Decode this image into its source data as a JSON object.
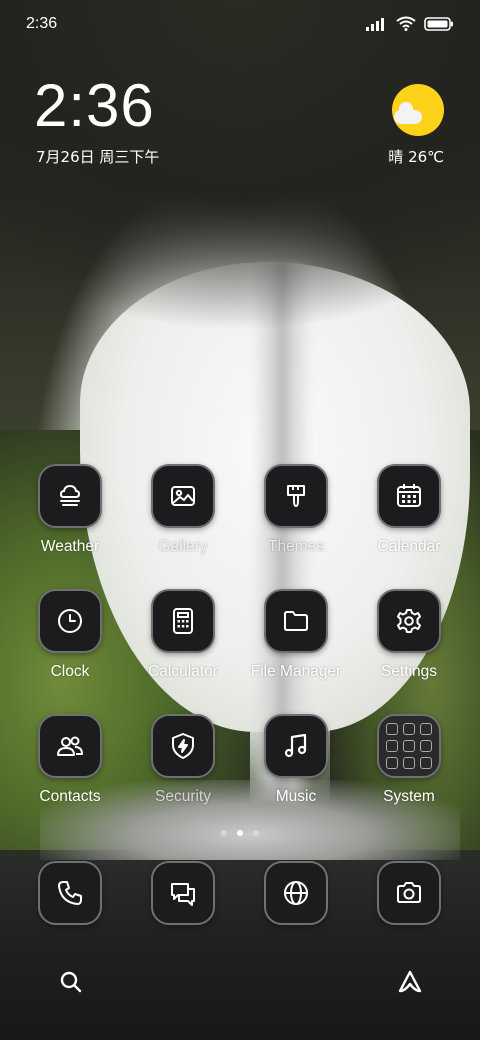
{
  "status_bar": {
    "time": "2:36"
  },
  "clock_widget": {
    "time": "2:36",
    "date": "7月26日 周三下午"
  },
  "weather_widget": {
    "text": "晴 26℃",
    "icon": "sun-cloud-icon",
    "sun_color": "#ffd21a"
  },
  "apps": [
    {
      "label": "Weather",
      "icon": "weather-icon"
    },
    {
      "label": "Gallery",
      "icon": "gallery-icon"
    },
    {
      "label": "Themes",
      "icon": "brush-icon"
    },
    {
      "label": "Calendar",
      "icon": "calendar-icon"
    },
    {
      "label": "Clock",
      "icon": "clock-icon"
    },
    {
      "label": "Calculator",
      "icon": "calculator-icon"
    },
    {
      "label": "File Manager",
      "icon": "folder-icon"
    },
    {
      "label": "Settings",
      "icon": "gear-icon"
    },
    {
      "label": "Contacts",
      "icon": "contacts-icon"
    },
    {
      "label": "Security",
      "icon": "shield-icon"
    },
    {
      "label": "Music",
      "icon": "music-note-icon"
    },
    {
      "label": "System",
      "icon": "folder-grid-icon"
    }
  ],
  "dock": [
    {
      "icon": "phone-icon"
    },
    {
      "icon": "messages-icon"
    },
    {
      "icon": "browser-globe-icon"
    },
    {
      "icon": "camera-icon"
    }
  ],
  "page_indicator": {
    "pages": 3,
    "current": 2
  },
  "bottom_bar": {
    "left_icon": "search-icon",
    "right_icon": "assistant-icon"
  }
}
